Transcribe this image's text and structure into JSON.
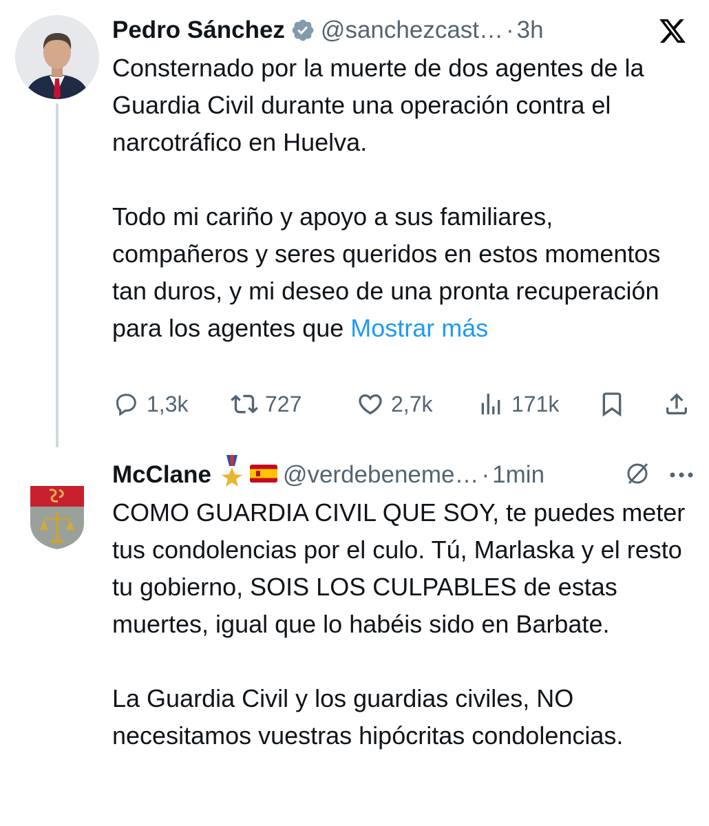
{
  "tweet1": {
    "author_name": "Pedro Sánchez",
    "handle": "@sanchezcast…",
    "dot": "·",
    "time": "3h",
    "paragraph1": "Consternado por la muerte de dos agentes de la Guardia Civil durante una operación contra el narcotráfico en Huelva.",
    "paragraph2": "Todo mi cariño y apoyo a sus familiares, compañeros y seres queridos en estos momentos tan duros, y mi deseo de una pronta recuperación para los agentes que",
    "show_more": "Mostrar más",
    "replies": "1,3k",
    "reposts": "727",
    "likes": "2,7k",
    "views": "171k",
    "icons": {
      "verified": "verified-badge-icon",
      "x_logo": "x-logo-icon",
      "reply": "reply-icon",
      "repost": "repost-icon",
      "like": "heart-icon",
      "views": "views-icon",
      "bookmark": "bookmark-icon",
      "share": "share-icon"
    }
  },
  "tweet2": {
    "author_name": "McClane",
    "handle": "@verdebeneme…",
    "dot": "·",
    "time": "1min",
    "paragraph1": "COMO GUARDIA CIVIL QUE SOY, te puedes meter tus condolencias por el culo. Tú, Marlaska y el resto tu gobierno, SOIS LOS CULPABLES de estas muertes, igual que lo habéis sido en Barbate.",
    "paragraph2": "La Guardia Civil y los guardias civiles, NO necesitamos vuestras hipócritas condolencias.",
    "icons": {
      "medal": "medal-icon",
      "flag": "spain-flag-icon",
      "grok": "slash-circle-icon",
      "more": "more-options-icon"
    }
  },
  "colors": {
    "text": "#0f1419",
    "secondary": "#536471",
    "link": "#1d9bf0",
    "verified": "#829aab",
    "thread_line": "#cfd9de"
  }
}
